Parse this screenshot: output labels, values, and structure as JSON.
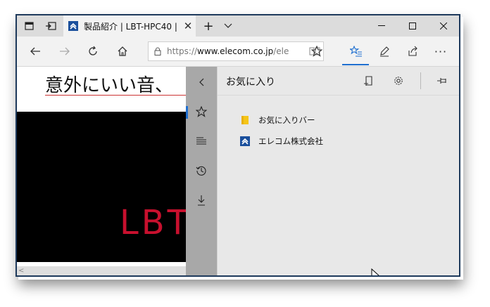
{
  "tab": {
    "title": "製品紹介 | LBT-HPC40 |"
  },
  "address": {
    "url_prefix": "https://",
    "url_domain": "www.elecom.co.jp",
    "url_rest": "/ele"
  },
  "page": {
    "heading": "意外にいい音、",
    "video_text": "LBT"
  },
  "hub": {
    "title": "お気に入り",
    "items": [
      {
        "label": "お気に入りバー",
        "icon": "folder-icon"
      },
      {
        "label": "エレコム株式会社",
        "icon": "elecom-favicon"
      }
    ]
  },
  "colors": {
    "accent": "#1f6fd0",
    "rail": "#a8a8a8",
    "hub_bg": "#e8e8e8",
    "video_text": "#c8102e",
    "frame": "#1e3a5c"
  }
}
